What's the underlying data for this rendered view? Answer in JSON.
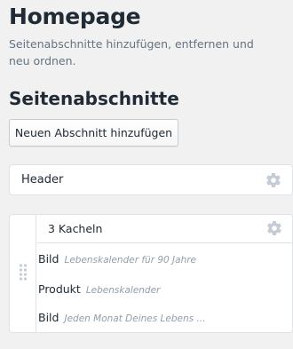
{
  "page": {
    "title": "Homepage",
    "description": "Seitenabschnitte hinzufügen, entfernen und neu ordnen."
  },
  "sections": {
    "heading": "Seitenabschnitte",
    "add_button_label": "Neuen Abschnitt hinzufügen",
    "header_section": {
      "label": "Header",
      "icon": "gear-icon"
    },
    "group_section": {
      "label": "3 Kacheln",
      "icon": "gear-icon",
      "drag_icon": "drag-handle-icon",
      "blocks": [
        {
          "type": "Bild",
          "description": "Lebenskalender für 90 Jahre"
        },
        {
          "type": "Produkt",
          "description": "Lebenskalender"
        },
        {
          "type": "Bild",
          "description": "Jeden Monat Deines Lebens ..."
        }
      ]
    }
  },
  "colors": {
    "background": "#f1f1f1",
    "text": "#212b36",
    "muted": "#637381",
    "icon": "#c4cdd5",
    "border": "#dfe3e8"
  }
}
